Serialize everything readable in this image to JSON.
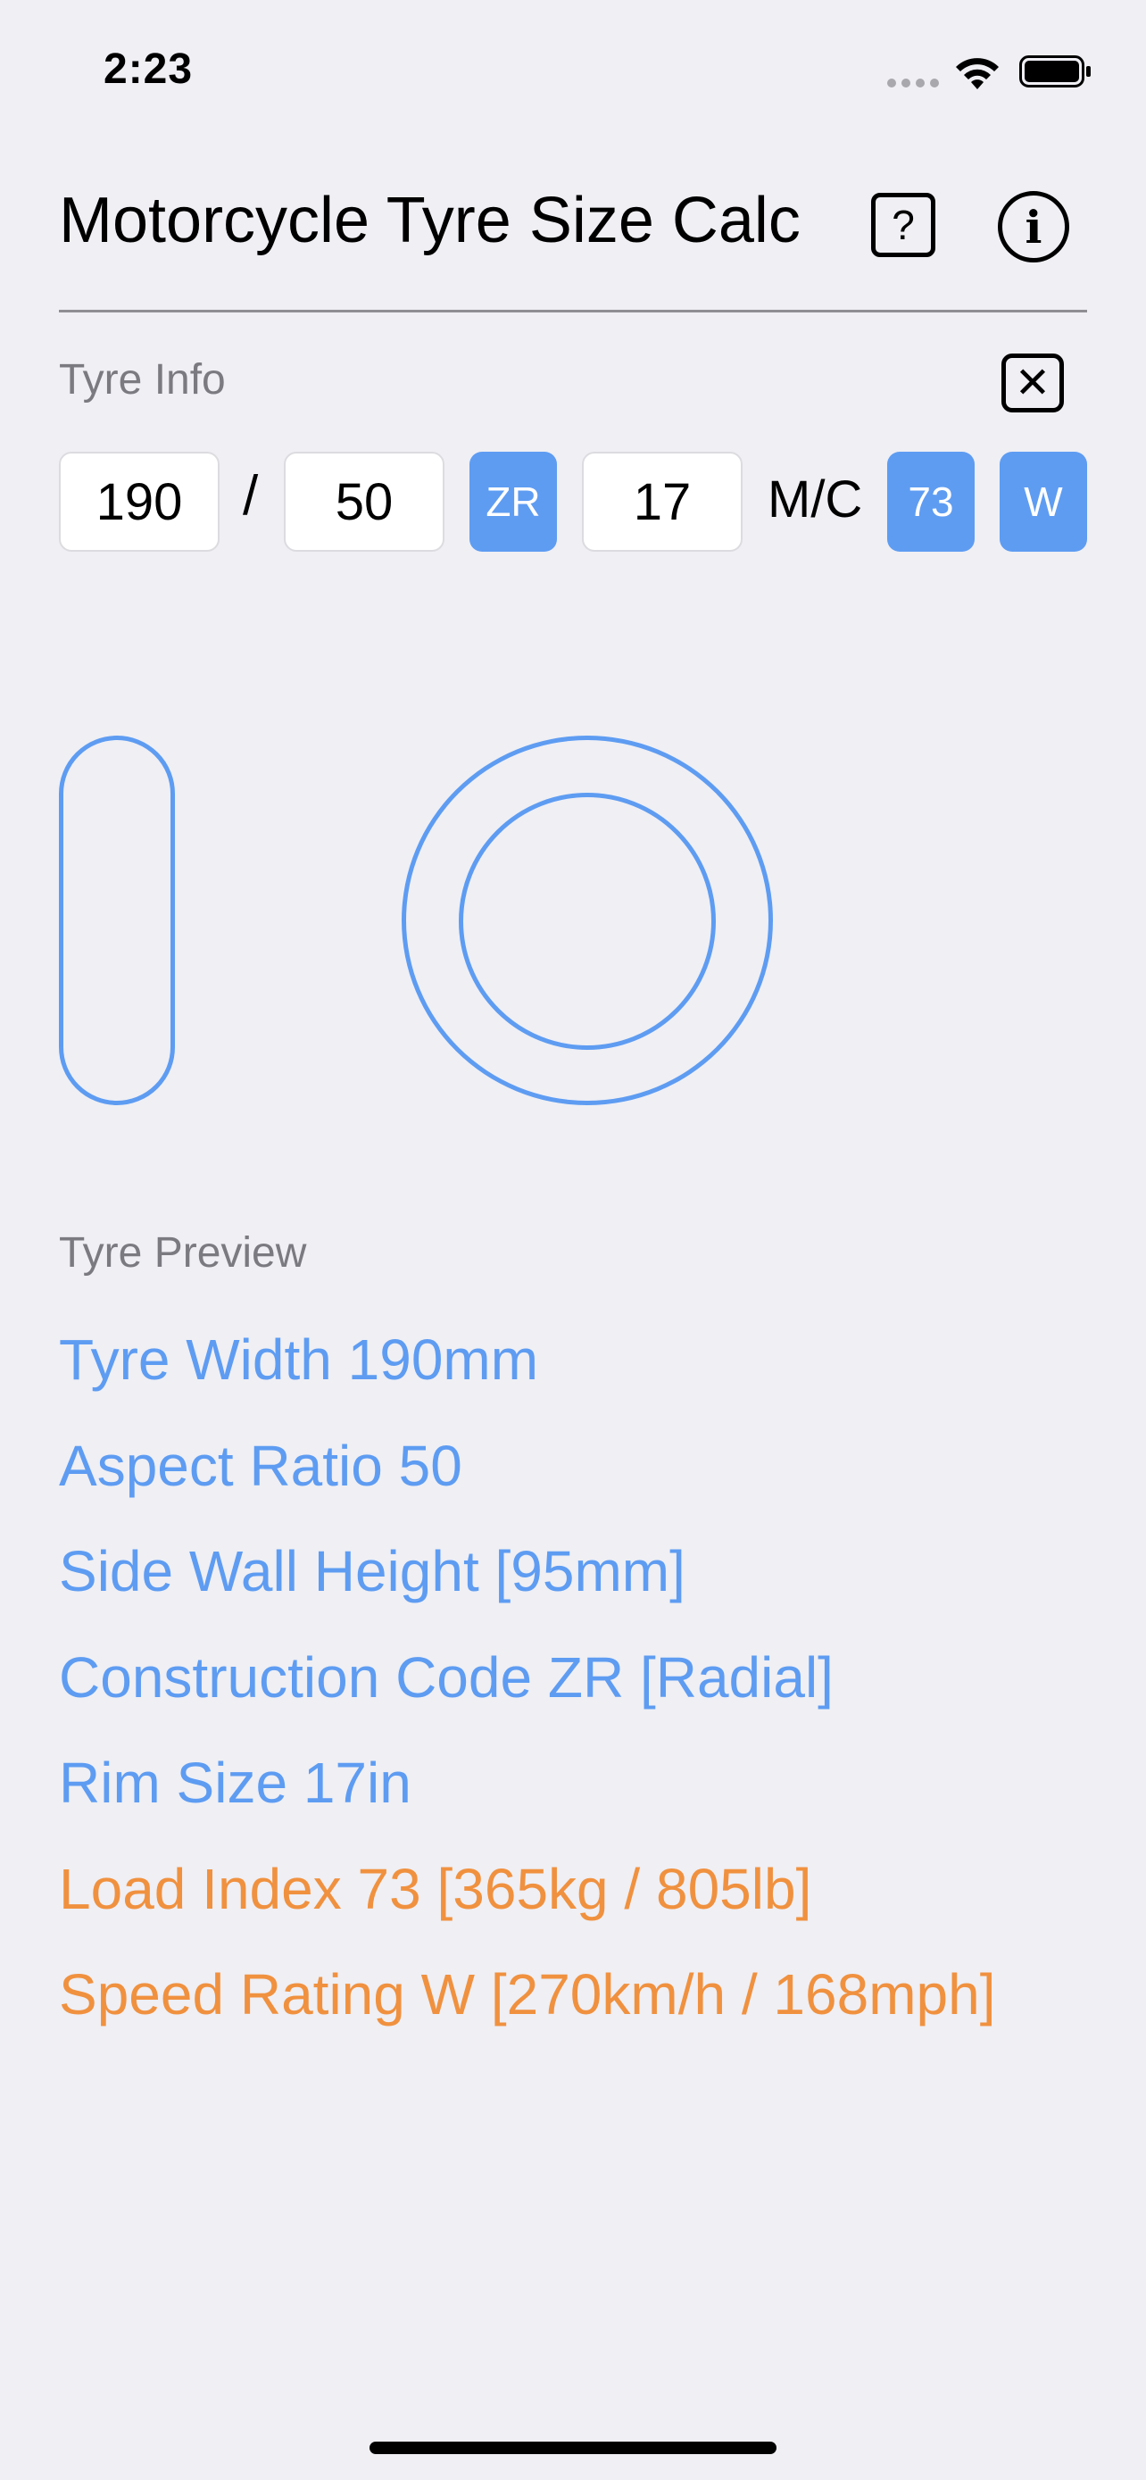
{
  "status_bar": {
    "time": "2:23"
  },
  "header": {
    "title": "Motorcycle Tyre Size Calc",
    "help_icon": "question-square-icon",
    "info_icon": "info-circle-icon",
    "help_glyph": "?",
    "info_glyph": "i"
  },
  "tyre_info": {
    "label": "Tyre Info",
    "clear_glyph": "✕",
    "width": "190",
    "separator": "/",
    "aspect": "50",
    "construction": "ZR",
    "rim": "17",
    "suffix": "M/C",
    "load_index": "73",
    "speed_rating": "W"
  },
  "preview": {
    "label": "Tyre Preview",
    "lines": [
      "Tyre Width 190mm",
      "Aspect Ratio 50",
      "Side Wall Height [95mm]",
      "Construction Code ZR [Radial]",
      "Rim Size 17in",
      "Load Index 73 [365kg / 805lb]",
      "Speed Rating W [270km/h / 168mph]"
    ]
  },
  "colors": {
    "accent_blue": "#5e9cf2",
    "accent_orange": "#f0913f",
    "background": "#efeff4"
  }
}
